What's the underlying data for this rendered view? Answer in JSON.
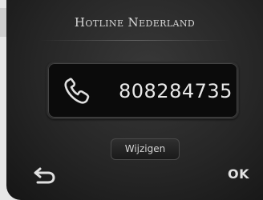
{
  "screen": {
    "title": "Hotline Nederland",
    "phone_number": "808284735",
    "edit_button_label": "Wijzigen",
    "ok_label": "OK"
  },
  "icons": {
    "phone": "phone-handset-icon",
    "back": "back-arrow-icon"
  },
  "colors": {
    "background": "#262626",
    "text": "#e8e8e8"
  }
}
